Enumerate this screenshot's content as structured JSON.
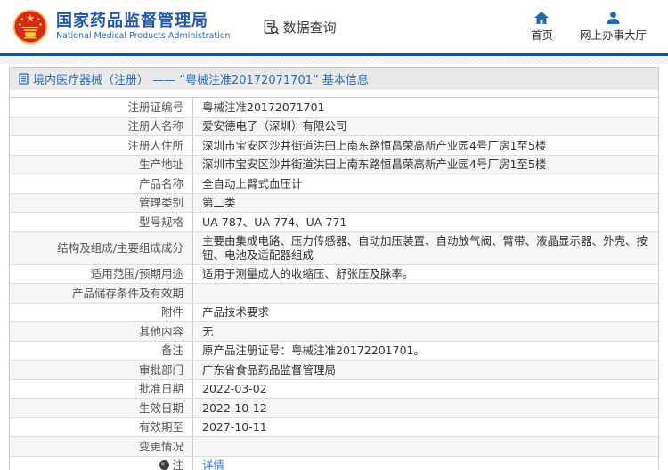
{
  "header": {
    "site_title": "国家药品监督管理局",
    "site_subtitle": "National Medical Products Administration",
    "emblem_icon": "china-national-emblem",
    "data_query_label": "数据查询",
    "nav": [
      {
        "icon": "home-icon",
        "label": "首页"
      },
      {
        "icon": "user-icon",
        "label": "网上办事大厅"
      }
    ]
  },
  "page": {
    "section_title": "境内医疗器械（注册） —— “粤械注准20172071701” 基本信息"
  },
  "table": {
    "rows": [
      {
        "label": "注册证编号",
        "value": "粤械注准20172071701"
      },
      {
        "label": "注册人名称",
        "value": "爱安德电子（深圳）有限公司"
      },
      {
        "label": "注册人住所",
        "value": "深圳市宝安区沙井街道洪田上南东路恒昌荣高新产业园4号厂房1至5楼"
      },
      {
        "label": "生产地址",
        "value": "深圳市宝安区沙井街道洪田上南东路恒昌荣高新产业园4号厂房1至5楼"
      },
      {
        "label": "产品名称",
        "value": "全自动上臂式血压计"
      },
      {
        "label": "管理类别",
        "value": "第二类"
      },
      {
        "label": "型号规格",
        "value": "UA-787、UA-774、UA-771"
      },
      {
        "label": "结构及组成/主要组成成分",
        "value": "主要由集成电路、压力传感器、自动加压装置、自动放气阀、臂带、液晶显示器、外壳、按钮、电池及适配器组成"
      },
      {
        "label": "适用范围/预期用途",
        "value": "适用于测量成人的收缩压、舒张压及脉率。"
      },
      {
        "label": "产品储存条件及有效期",
        "value": ""
      },
      {
        "label": "附件",
        "value": "产品技术要求"
      },
      {
        "label": "其他内容",
        "value": "无"
      },
      {
        "label": "备注",
        "value": "原产品注册证号：粤械注准20172201701。"
      },
      {
        "label": "审批部门",
        "value": "广东省食品药品监督管理局"
      },
      {
        "label": "批准日期",
        "value": "2022-03-02"
      },
      {
        "label": "生效日期",
        "value": "2022-10-12"
      },
      {
        "label": "有效期至",
        "value": "2027-10-11"
      },
      {
        "label": "变更情况",
        "value": ""
      },
      {
        "label": "注",
        "value": "详情",
        "link": true,
        "label_icon": "bulb-icon"
      }
    ]
  },
  "colors": {
    "brand_blue": "#1e5aa9",
    "rule_blue": "#1c4c99",
    "link_blue": "#3e85d6",
    "title_bar_bg": "#e9e9e9",
    "alt_row_bg": "#f6f6f6",
    "emblem_red": "#d7281d",
    "emblem_gold": "#f4c945"
  }
}
